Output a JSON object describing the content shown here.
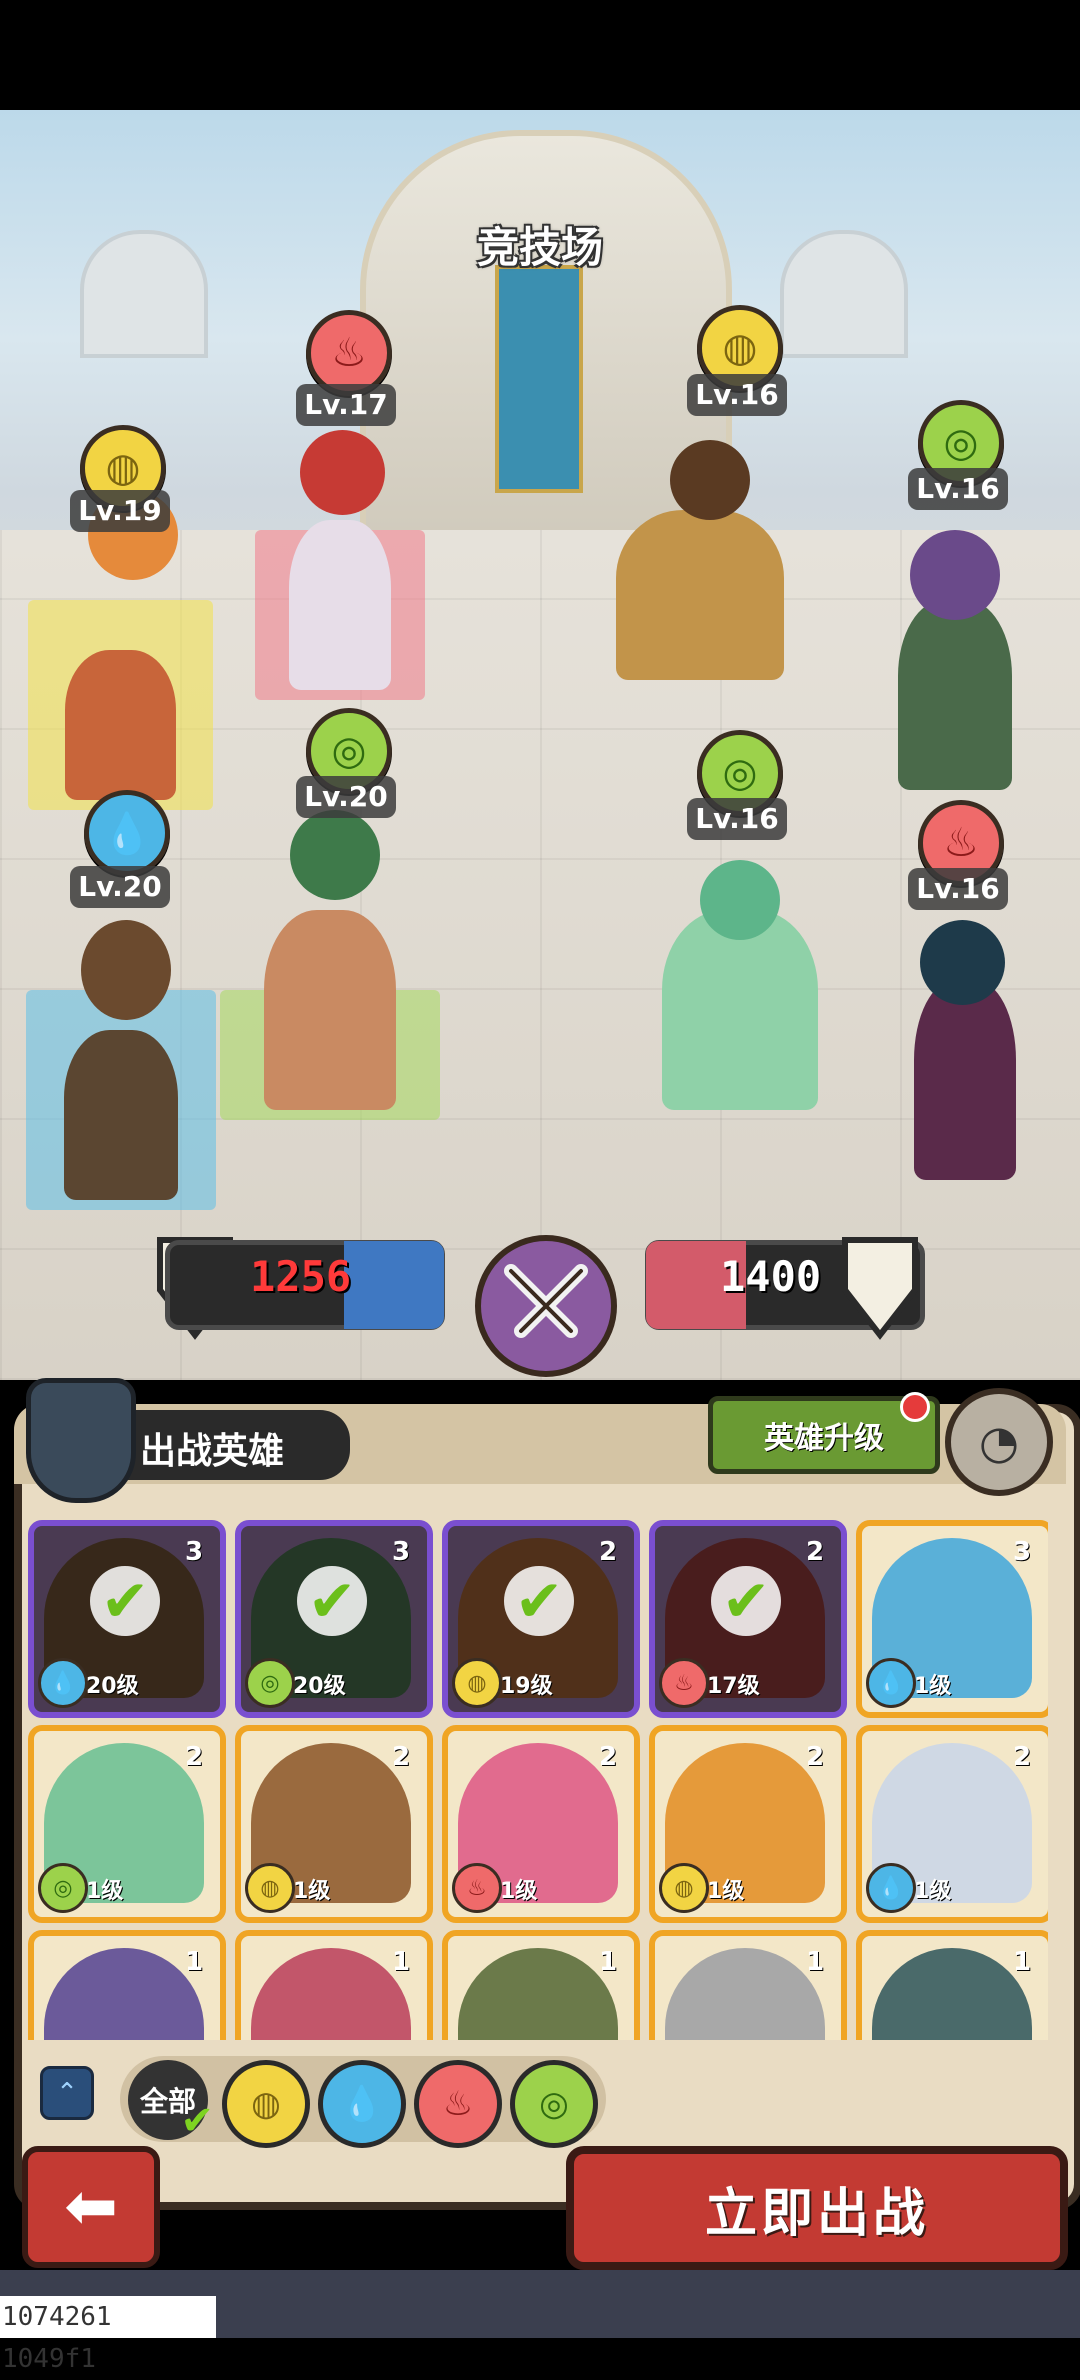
{
  "screen": {
    "title": "竞技场"
  },
  "colors": {
    "wind": "#9cd24b",
    "earth": "#f2d443",
    "water": "#4db6e6",
    "fire": "#ef6a6a",
    "panel": "#e9dcc3",
    "button_red": "#c33a33",
    "upgrade_green": "#6a9a33"
  },
  "battlefield": {
    "player_team": [
      {
        "level": "Lv.19",
        "element": "earth"
      },
      {
        "level": "Lv.17",
        "element": "fire"
      },
      {
        "level": "Lv.20",
        "element": "water"
      },
      {
        "level": "Lv.20",
        "element": "wind"
      }
    ],
    "enemy_team": [
      {
        "level": "Lv.16",
        "element": "earth"
      },
      {
        "level": "Lv.16",
        "element": "wind"
      },
      {
        "level": "Lv.16",
        "element": "wind"
      },
      {
        "level": "Lv.16",
        "element": "fire"
      }
    ]
  },
  "power": {
    "player": "1256",
    "enemy": "1400"
  },
  "panel": {
    "title": "出战英雄",
    "upgrade_label": "英雄升级",
    "cards": [
      {
        "stars": "3",
        "element": "water",
        "level": "20级",
        "selected": true,
        "tone": "#7a5a3a"
      },
      {
        "stars": "3",
        "element": "wind",
        "level": "20级",
        "selected": true,
        "tone": "#4f7a55"
      },
      {
        "stars": "2",
        "element": "earth",
        "level": "19级",
        "selected": true,
        "tone": "#b26a3a"
      },
      {
        "stars": "2",
        "element": "fire",
        "level": "17级",
        "selected": true,
        "tone": "#a34141"
      },
      {
        "stars": "3",
        "element": "water",
        "level": "1级",
        "selected": false,
        "tone": "#5ab0d8"
      },
      {
        "stars": "2",
        "element": "wind",
        "level": "1级",
        "selected": false,
        "tone": "#7cc59a"
      },
      {
        "stars": "2",
        "element": "earth",
        "level": "1级",
        "selected": false,
        "tone": "#9a6a3e"
      },
      {
        "stars": "2",
        "element": "fire",
        "level": "1级",
        "selected": false,
        "tone": "#e16b8e"
      },
      {
        "stars": "2",
        "element": "earth",
        "level": "1级",
        "selected": false,
        "tone": "#e59a3a"
      },
      {
        "stars": "2",
        "element": "water",
        "level": "1级",
        "selected": false,
        "tone": "#cfd8e4"
      },
      {
        "stars": "1",
        "element": "",
        "level": "",
        "selected": false,
        "tone": "#6b5a9a"
      },
      {
        "stars": "1",
        "element": "",
        "level": "",
        "selected": false,
        "tone": "#c2566a"
      },
      {
        "stars": "1",
        "element": "",
        "level": "",
        "selected": false,
        "tone": "#6b7a4a"
      },
      {
        "stars": "1",
        "element": "",
        "level": "",
        "selected": false,
        "tone": "#a8a8a8"
      },
      {
        "stars": "1",
        "element": "",
        "level": "",
        "selected": false,
        "tone": "#4a6a6a"
      }
    ],
    "filters": {
      "all_label": "全部",
      "elements": [
        "earth",
        "water",
        "fire",
        "wind"
      ]
    }
  },
  "actions": {
    "battle_label": "立即出战"
  },
  "debug_text": "1074261 1049f1"
}
